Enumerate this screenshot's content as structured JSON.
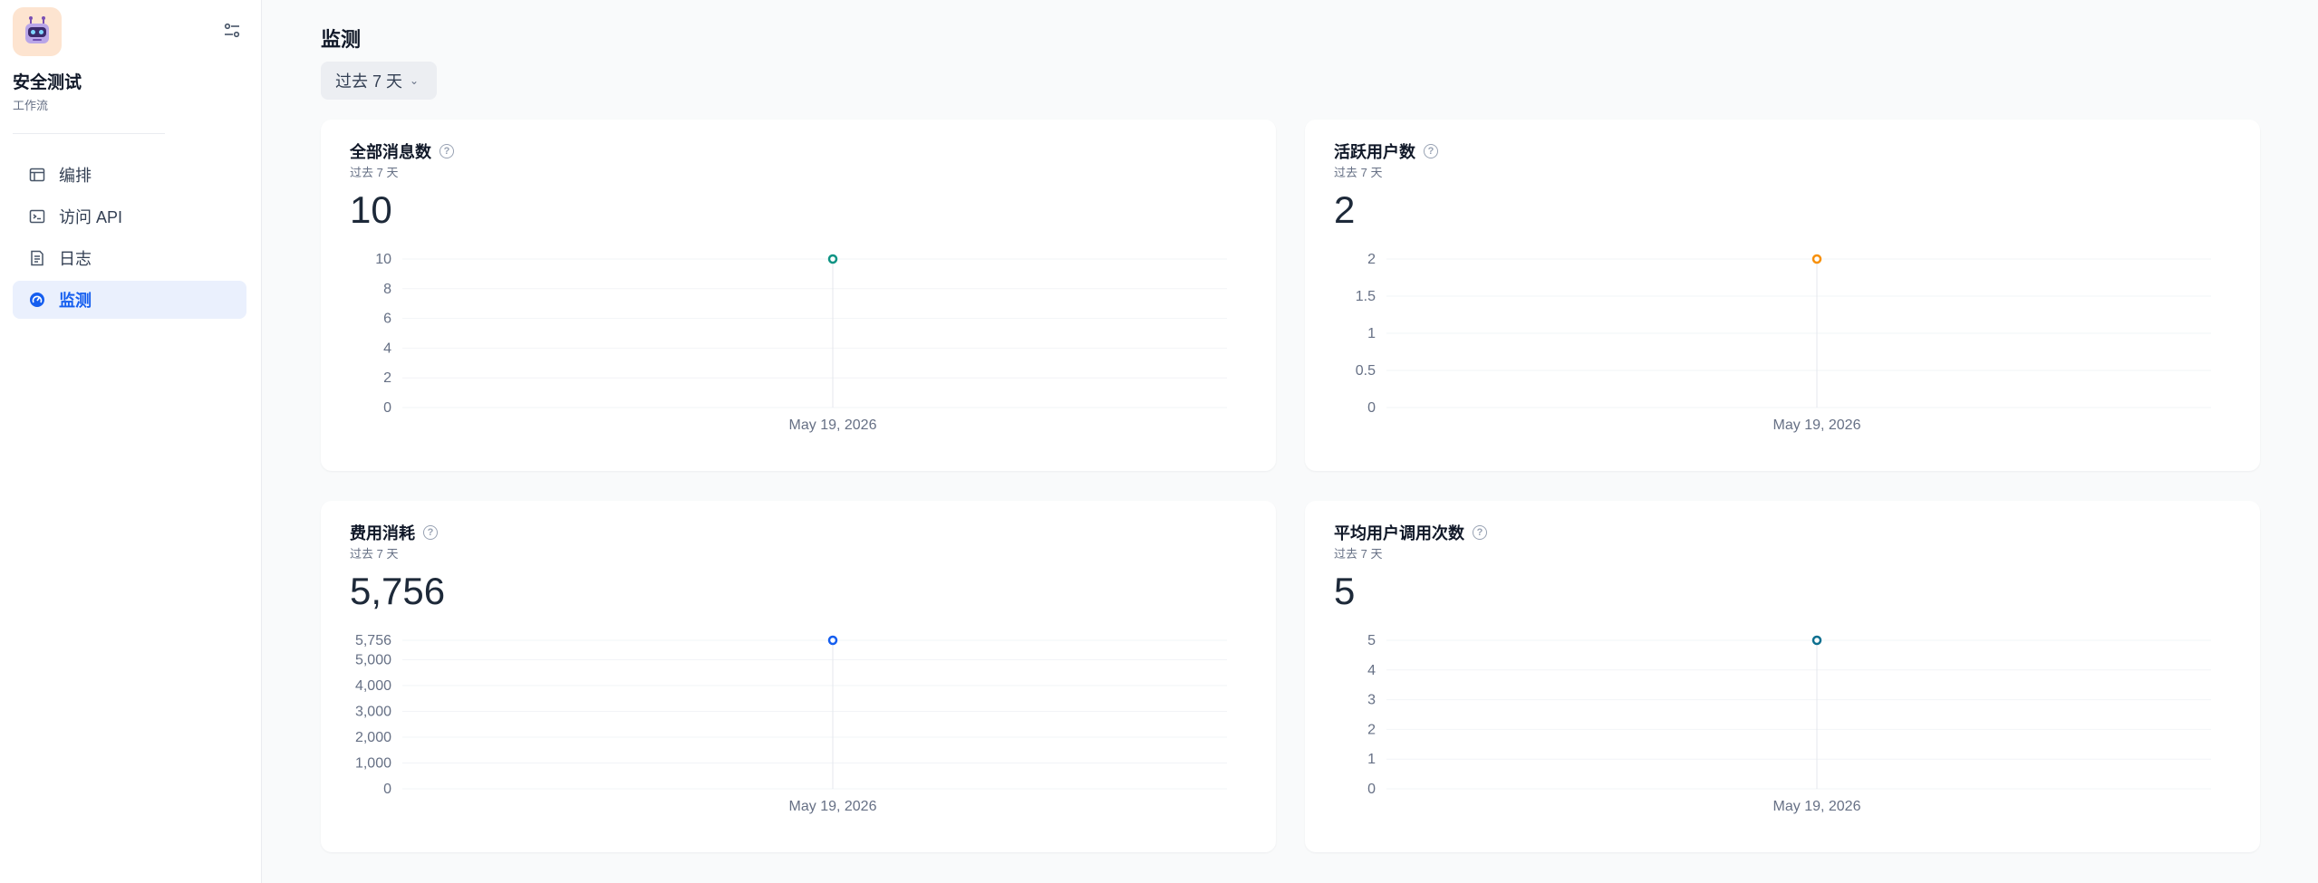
{
  "sidebar": {
    "app_name": "安全测试",
    "app_type": "工作流",
    "items": [
      {
        "label": "编排",
        "icon": "layout-icon",
        "active": false
      },
      {
        "label": "访问 API",
        "icon": "terminal-icon",
        "active": false
      },
      {
        "label": "日志",
        "icon": "document-icon",
        "active": false
      },
      {
        "label": "监测",
        "icon": "gauge-icon",
        "active": true
      }
    ]
  },
  "main": {
    "title": "监测",
    "period": "过去 7 天"
  },
  "colors": {
    "accent": "#155eef",
    "teal": "#0e9384",
    "orange": "#f79009",
    "blue": "#155eef",
    "cyan": "#0e7090"
  },
  "cards": [
    {
      "title": "全部消息数",
      "subtitle": "过去 7 天",
      "value": "10"
    },
    {
      "title": "活跃用户数",
      "subtitle": "过去 7 天",
      "value": "2"
    },
    {
      "title": "费用消耗",
      "subtitle": "过去 7 天",
      "value": "5,756"
    },
    {
      "title": "平均用户调用次数",
      "subtitle": "过去 7 天",
      "value": "5"
    }
  ],
  "chart_data": [
    {
      "type": "line",
      "x": [
        "May 19, 2026"
      ],
      "series": [
        {
          "values": [
            10
          ]
        }
      ],
      "yticks": [
        "0",
        "2",
        "4",
        "6",
        "8",
        "10"
      ],
      "ylim": [
        0,
        10
      ],
      "color": "#0e9384",
      "grid": true
    },
    {
      "type": "line",
      "x": [
        "May 19, 2026"
      ],
      "series": [
        {
          "values": [
            2
          ]
        }
      ],
      "yticks": [
        "0",
        "0.5",
        "1",
        "1.5",
        "2"
      ],
      "ylim": [
        0,
        2
      ],
      "color": "#f79009",
      "grid": true
    },
    {
      "type": "line",
      "x": [
        "May 19, 2026"
      ],
      "series": [
        {
          "values": [
            5756
          ]
        }
      ],
      "yticks": [
        "0",
        "1,000",
        "2,000",
        "3,000",
        "4,000",
        "5,000",
        "5,756"
      ],
      "ylim": [
        0,
        5756
      ],
      "color": "#155eef",
      "grid": true
    },
    {
      "type": "line",
      "x": [
        "May 19, 2026"
      ],
      "series": [
        {
          "values": [
            5
          ]
        }
      ],
      "yticks": [
        "0",
        "1",
        "2",
        "3",
        "4",
        "5"
      ],
      "ylim": [
        0,
        5
      ],
      "color": "#0e7090",
      "grid": true
    }
  ]
}
